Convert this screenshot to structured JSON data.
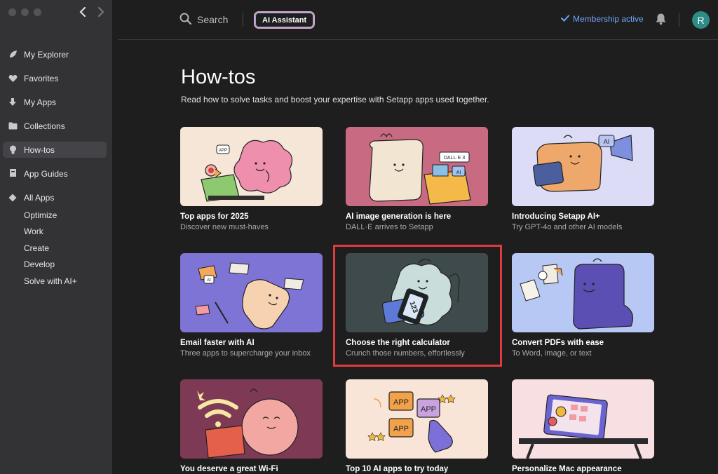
{
  "sidebar": {
    "items": [
      {
        "label": "My Explorer",
        "icon": "leaf-icon"
      },
      {
        "label": "Favorites",
        "icon": "heart-icon"
      },
      {
        "label": "My Apps",
        "icon": "download-arrow-icon"
      },
      {
        "label": "Collections",
        "icon": "folder-icon"
      },
      {
        "label": "How-tos",
        "icon": "lightbulb-icon",
        "active": true
      },
      {
        "label": "App Guides",
        "icon": "book-icon"
      },
      {
        "label": "All Apps",
        "icon": "diamond-icon"
      }
    ],
    "subitems": [
      "Optimize",
      "Work",
      "Create",
      "Develop",
      "Solve with AI+"
    ]
  },
  "topbar": {
    "search_label": "Search",
    "ai_button": "AI Assistant",
    "membership": "Membership active",
    "avatar_initial": "R"
  },
  "main": {
    "title": "How-tos",
    "subtitle": "Read how to solve tasks and boost your expertise with Setapp apps used together.",
    "cards": [
      {
        "title": "Top apps for 2025",
        "subtitle": "Discover new must-haves",
        "bg": "#f5e6d8"
      },
      {
        "title": "AI image generation is here",
        "subtitle": "DALL·E arrives to Setapp",
        "bg": "#c86b82"
      },
      {
        "title": "Introducing Setapp AI+",
        "subtitle": "Try GPT-4o and other AI models",
        "bg": "#dcdcf7"
      },
      {
        "title": "Email faster with AI",
        "subtitle": "Three apps to supercharge your inbox",
        "bg": "#7e74d6"
      },
      {
        "title": "Choose the right calculator",
        "subtitle": "Crunch those numbers, effortlessly",
        "bg": "#3f4a4c"
      },
      {
        "title": "Convert PDFs with ease",
        "subtitle": "To Word, image, or text",
        "bg": "#b7c8f4"
      },
      {
        "title": "You deserve a great Wi-Fi",
        "subtitle": "",
        "bg": "#7e3a55"
      },
      {
        "title": "Top 10 AI apps to try today",
        "subtitle": "",
        "bg": "#f8e5d8"
      },
      {
        "title": "Personalize Mac appearance",
        "subtitle": "",
        "bg": "#f7dfe2"
      }
    ],
    "art_text": {
      "app_tag": "APP",
      "dalle": "DALL·E 3",
      "ai": "AI",
      "calc": "123",
      "app1": "APP",
      "app2": "APP",
      "app3": "APP"
    }
  },
  "colors": {
    "sidebar_bg": "#333235",
    "main_bg": "#1f1e1f",
    "accent_blue": "#6ea6f5",
    "highlight_red": "#e0393f",
    "avatar": "#2e8c86"
  }
}
